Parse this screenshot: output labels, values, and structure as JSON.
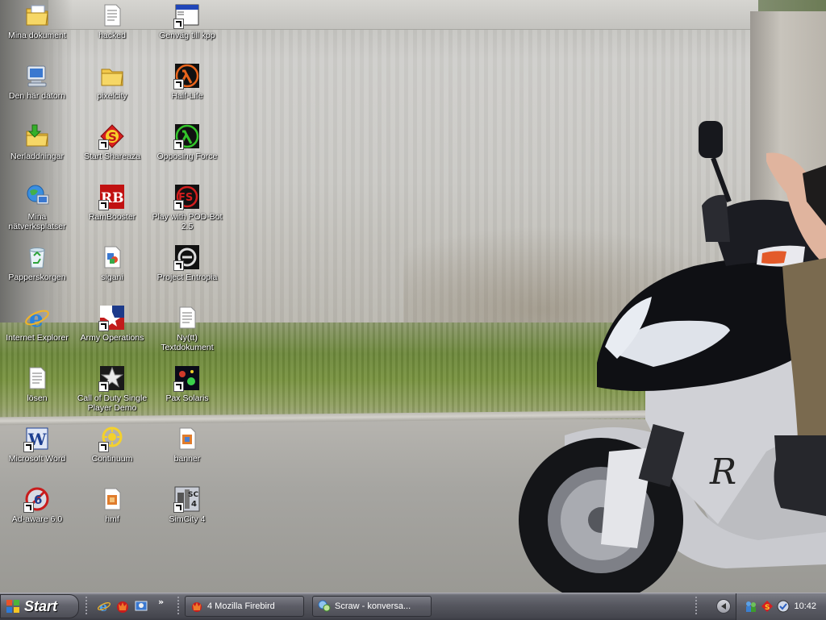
{
  "desktop": {
    "icons": [
      {
        "label": "Mina dokument",
        "icon": "my-documents-folder-icon",
        "shortcut": false
      },
      {
        "label": "hacked",
        "icon": "text-file-icon",
        "shortcut": false
      },
      {
        "label": "Genväg till kpp",
        "icon": "application-window-icon",
        "shortcut": true
      },
      {
        "label": "Den här datorn",
        "icon": "my-computer-icon",
        "shortcut": false
      },
      {
        "label": "pixelcity",
        "icon": "folder-icon",
        "shortcut": false
      },
      {
        "label": "Half-Life",
        "icon": "half-life-lambda-icon",
        "shortcut": true
      },
      {
        "label": "Nerladdningar",
        "icon": "downloads-folder-icon",
        "shortcut": false
      },
      {
        "label": "Start Shareaza",
        "icon": "shareaza-icon",
        "shortcut": true
      },
      {
        "label": "Opposing Force",
        "icon": "opposing-force-lambda-icon",
        "shortcut": true
      },
      {
        "label": "Mina nätverksplatser",
        "icon": "network-places-icon",
        "shortcut": false
      },
      {
        "label": "RamBooster",
        "icon": "rambooster-icon",
        "shortcut": true
      },
      {
        "label": "Play with POD-Bot 2.5",
        "icon": "pod-bot-icon",
        "shortcut": true
      },
      {
        "label": "Papperskorgen",
        "icon": "recycle-bin-icon",
        "shortcut": false
      },
      {
        "label": "sigani",
        "icon": "image-file-icon",
        "shortcut": false
      },
      {
        "label": "Project Entropia",
        "icon": "project-entropia-icon",
        "shortcut": true
      },
      {
        "label": "Internet Explorer",
        "icon": "internet-explorer-icon",
        "shortcut": false
      },
      {
        "label": "Army Operations",
        "icon": "army-operations-icon",
        "shortcut": true
      },
      {
        "label": "Ny(tt) Textdokument",
        "icon": "text-file-icon",
        "shortcut": false
      },
      {
        "label": "lösen",
        "icon": "text-file-icon",
        "shortcut": false
      },
      {
        "label": "Call of Duty Single Player Demo",
        "icon": "call-of-duty-star-icon",
        "shortcut": true
      },
      {
        "label": "Pax Solaris",
        "icon": "pax-solaris-icon",
        "shortcut": true
      },
      {
        "label": "Microsoft Word",
        "icon": "microsoft-word-icon",
        "shortcut": true
      },
      {
        "label": "Continuum",
        "icon": "continuum-icon",
        "shortcut": true
      },
      {
        "label": "banner",
        "icon": "image-file-icon",
        "shortcut": false
      },
      {
        "label": "Ad-aware 6.0",
        "icon": "ad-aware-icon",
        "shortcut": true
      },
      {
        "label": "hmf",
        "icon": "image-file-icon",
        "shortcut": false
      },
      {
        "label": "SimCity 4",
        "icon": "simcity-4-icon",
        "shortcut": true
      }
    ]
  },
  "taskbar": {
    "start_label": "Start",
    "quick_launch": [
      {
        "icon": "internet-explorer-icon"
      },
      {
        "icon": "firebird-icon"
      },
      {
        "icon": "desktop-settings-icon"
      }
    ],
    "more_label": "»",
    "tasks": [
      {
        "label": "4 Mozilla Firebird",
        "icon": "firebird-icon"
      },
      {
        "label": "Scraw - konversa...",
        "icon": "chat-icon"
      }
    ],
    "tray": {
      "icons": [
        "network-users-icon",
        "shareaza-tray-icon",
        "messenger-tray-icon"
      ],
      "clock": "10:42"
    }
  }
}
